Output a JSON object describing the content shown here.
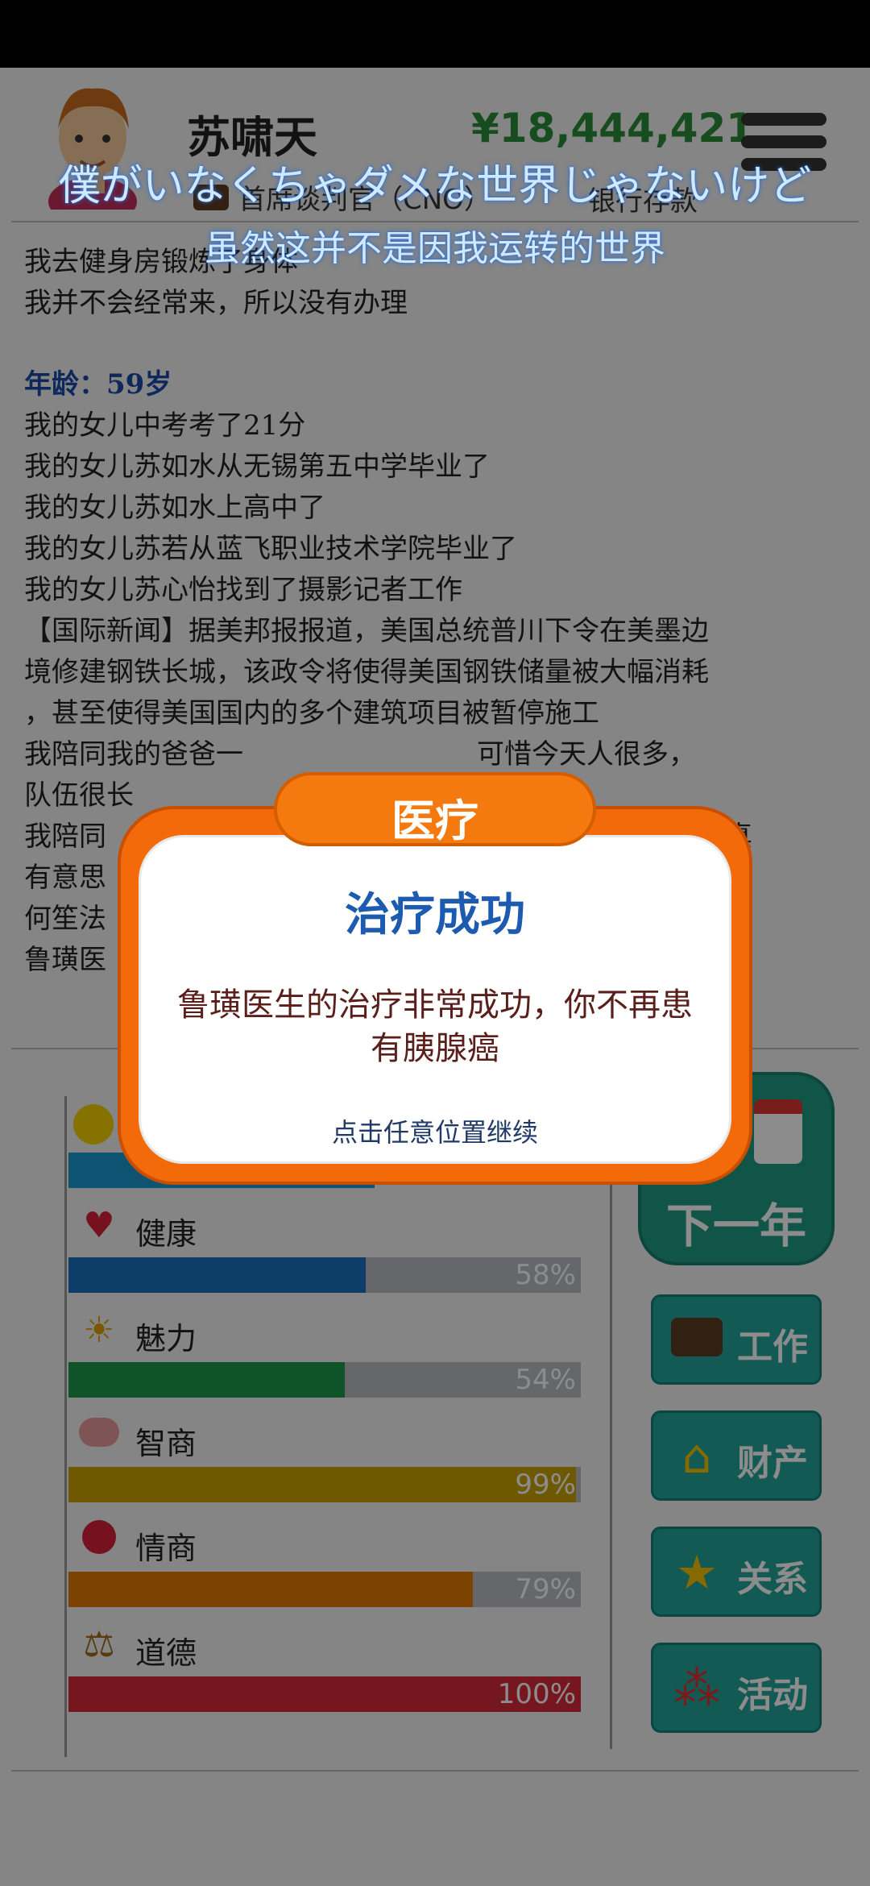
{
  "header": {
    "name": "苏啸天",
    "money": "¥18,444,421",
    "job": "首席谈判官（CNO）",
    "bank_label": "银行存款"
  },
  "subtitles": {
    "line1": "僕がいなくちゃダメな世界じゃないけど",
    "line2": "虽然这并不是因我运转的世界"
  },
  "log": {
    "lines_before_age": [
      "我去健身房锻炼了身体",
      "我并不会经常来，所以没有办理"
    ],
    "age": "年龄：59岁",
    "lines": [
      "我的女儿中考考了21分",
      "我的女儿苏如水从无锡第五中学毕业了",
      "我的女儿苏如水上高中了",
      "我的女儿苏若从蓝飞职业技术学院毕业了",
      "我的女儿苏心怡找到了摄影记者工作",
      "【国际新闻】据美邦报报道，美国总统普川下令在美墨边",
      "境修建钢铁长城，该政令将使得美国钢铁储量被大幅消耗",
      "，甚至使得美国国内的多个建筑项目被暂停施工",
      "我陪同我的爸爸一",
      "队伍很长",
      "我陪同",
      "有意思",
      "何笙法",
      "鲁璜医"
    ],
    "line9_tail": "可惜今天人很多，",
    "line11_tail": "寺可真"
  },
  "attributes": [
    {
      "key": "health",
      "label": "健康",
      "value": 58,
      "display": "58%",
      "color": "#1a6fc0",
      "icon": "heart-icon"
    },
    {
      "key": "charm",
      "label": "魅力",
      "value": 54,
      "display": "54%",
      "color": "#1a9a4a",
      "icon": "sun-icon"
    },
    {
      "key": "iq",
      "label": "智商",
      "value": 99,
      "display": "99%",
      "color": "#c9a200",
      "icon": "brain-icon"
    },
    {
      "key": "eq",
      "label": "情商",
      "value": 79,
      "display": "79%",
      "color": "#e07800",
      "icon": "apple-icon"
    },
    {
      "key": "morality",
      "label": "道德",
      "value": 100,
      "display": "100%",
      "color": "#d8283a",
      "icon": "scale-icon"
    }
  ],
  "side": {
    "next_year": "下一年",
    "buttons": [
      {
        "label": "工作",
        "icon": "briefcase-icon"
      },
      {
        "label": "财产",
        "icon": "house-icon"
      },
      {
        "label": "关系",
        "icon": "star-icon"
      },
      {
        "label": "活动",
        "icon": "molecule-icon"
      }
    ]
  },
  "dialog": {
    "tab": "医疗",
    "title": "治疗成功",
    "message": "鲁璜医生的治疗非常成功，你不再患有胰腺癌",
    "hint": "点击任意位置继续"
  }
}
